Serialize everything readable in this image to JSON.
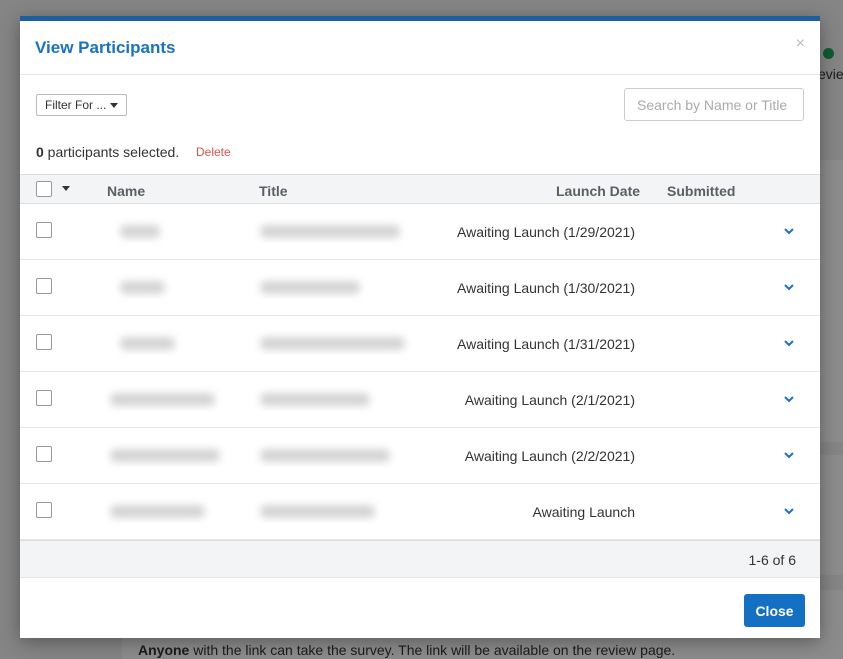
{
  "background": {
    "review_text": "eview",
    "footer_bold": "Anyone",
    "footer_text": " with the link can take the survey. The link will be available on the review page."
  },
  "modal": {
    "title": "View Participants",
    "close_glyph": "×",
    "filter_label": "Filter For ...",
    "search_placeholder": "Search by Name or Title",
    "selected_count": "0",
    "selected_suffix": " participants selected.",
    "delete_label": "Delete",
    "columns": {
      "name": "Name",
      "title": "Title",
      "launch_date": "Launch Date",
      "submitted": "Submitted"
    },
    "rows": [
      {
        "launch": "Awaiting Launch (1/29/2021)"
      },
      {
        "launch": "Awaiting Launch (1/30/2021)"
      },
      {
        "launch": "Awaiting Launch (1/31/2021)"
      },
      {
        "launch": "Awaiting Launch (2/1/2021)"
      },
      {
        "launch": "Awaiting Launch (2/2/2021)"
      },
      {
        "launch": "Awaiting Launch"
      }
    ],
    "pagination": "1-6 of 6",
    "close_button": "Close"
  },
  "colors": {
    "accent": "#1470c3",
    "title": "#1a73c2",
    "delete": "#d9534f"
  }
}
